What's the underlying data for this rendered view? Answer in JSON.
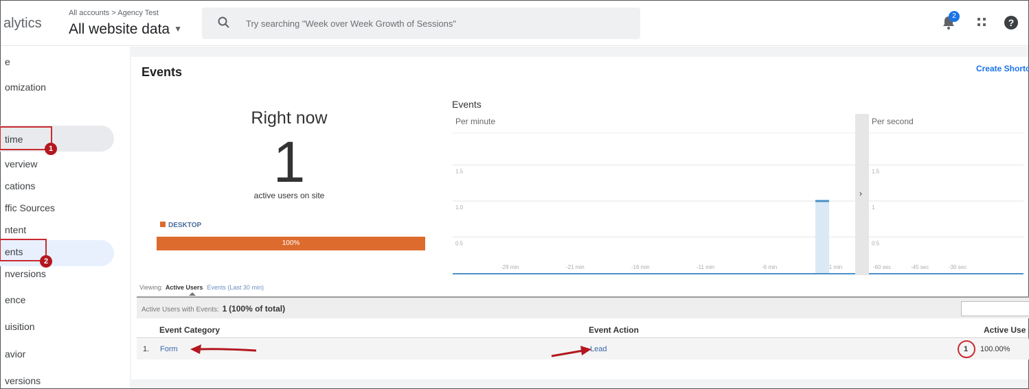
{
  "header": {
    "app_name": "alytics",
    "breadcrumb": "All accounts > Agency Test",
    "view_name": "All website data",
    "search_placeholder": "Try searching \"Week over Week Growth of Sessions\"",
    "notifications_count": "2"
  },
  "sidebar": {
    "items": [
      {
        "label": "e"
      },
      {
        "label": "omization"
      },
      {
        "label": "time"
      },
      {
        "label": "verview"
      },
      {
        "label": "cations"
      },
      {
        "label": "ffic Sources"
      },
      {
        "label": "ntent"
      },
      {
        "label": "ents"
      },
      {
        "label": "nversions"
      },
      {
        "label": "ence"
      },
      {
        "label": "uisition"
      },
      {
        "label": "avior"
      },
      {
        "label": "versions"
      }
    ],
    "markers": [
      "1",
      "2"
    ]
  },
  "main": {
    "title": "Events",
    "create_shortcut": "Create Shortcu",
    "right_now_label": "Right now",
    "active_count": "1",
    "active_label": "active users on site",
    "device_legend": "DESKTOP",
    "device_percent": "100%",
    "device_fraction": 1.0,
    "chart_title": "Events",
    "viewing_label": "Viewing:",
    "viewing_active": "Active Users",
    "viewing_other": "Events (Last 30 min)",
    "summary_label": "Active Users with Events:",
    "summary_value": "1",
    "summary_pct": "(100% of total)"
  },
  "table": {
    "columns": [
      "Event Category",
      "Event Action",
      "Active Use"
    ],
    "rows": [
      {
        "index": "1.",
        "category": "Form",
        "action": "Lead",
        "users": "1",
        "percent": "100.00%"
      }
    ]
  },
  "chart_data": [
    {
      "type": "bar",
      "title": "Per minute",
      "y_ticks": [
        "1.5",
        "1.0",
        "0.5"
      ],
      "ylim": [
        0,
        2
      ],
      "categories": [
        "-29 min",
        "-21 min",
        "-16 min",
        "-11 min",
        "-6 min",
        "-1 min"
      ],
      "values": [
        0,
        0,
        0,
        0,
        0,
        1
      ]
    },
    {
      "type": "bar",
      "title": "Per second",
      "y_ticks": [
        "1.5",
        "1",
        "0.5"
      ],
      "ylim": [
        0,
        2
      ],
      "categories": [
        "-60 sec",
        "-45 sec",
        "-30 sec"
      ],
      "values": [
        0,
        0,
        0
      ]
    }
  ]
}
